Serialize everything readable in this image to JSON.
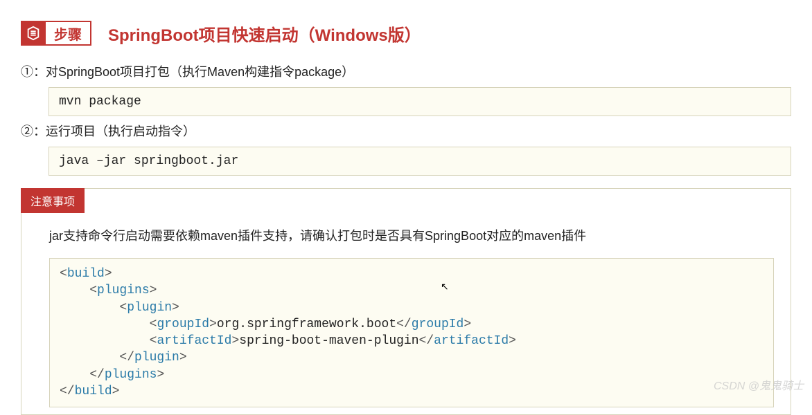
{
  "header": {
    "badge_label": "步骤",
    "title": "SpringBoot项目快速启动（Windows版）"
  },
  "steps": [
    {
      "label": "①：对SpringBoot项目打包（执行Maven构建指令package）",
      "code": "mvn package"
    },
    {
      "label": "②：运行项目（执行启动指令）",
      "code": "java –jar springboot.jar"
    }
  ],
  "notice": {
    "badge": "注意事项",
    "text": "jar支持命令行启动需要依赖maven插件支持，请确认打包时是否具有SpringBoot对应的maven插件",
    "xml": {
      "build_open": "build",
      "plugins_open": "plugins",
      "plugin_open": "plugin",
      "groupId_tag": "groupId",
      "groupId_val": "org.springframework.boot",
      "artifactId_tag": "artifactId",
      "artifactId_val": "spring-boot-maven-plugin",
      "plugin_close": "plugin",
      "plugins_close": "plugins",
      "build_close": "build"
    }
  },
  "watermark": "CSDN @鬼鬼骑士"
}
